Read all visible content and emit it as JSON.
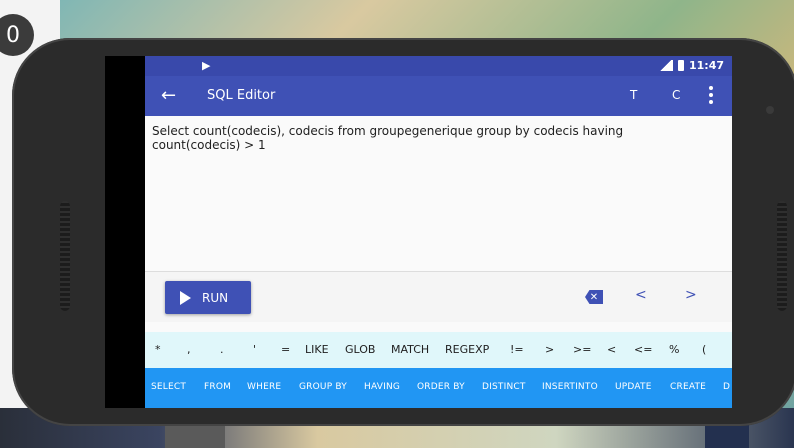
{
  "desktop": {
    "circle_letter": "0"
  },
  "statusbar": {
    "play_icon": "play-store-notification-icon",
    "signal_icon": "signal-icon",
    "battery_icon": "battery-icon",
    "time": "11:47"
  },
  "toolbar": {
    "back_icon": "back-arrow-icon",
    "title": "SQL Editor",
    "t_label": "T",
    "c_label": "C",
    "more_icon": "more-vert-icon"
  },
  "editor": {
    "query": "Select count(codecis), codecis from groupegenerique group by codecis having count(codecis) > 1"
  },
  "actions": {
    "run_label": "RUN",
    "backspace_icon": "backspace-icon",
    "prev_label": "<",
    "next_label": ">"
  },
  "operators": [
    "*",
    ",",
    ".",
    "'",
    "=",
    "LIKE",
    "GLOB",
    "MATCH",
    "REGEXP",
    "!=",
    ">",
    ">=",
    "<",
    "<=",
    "%",
    "("
  ],
  "keywords": [
    "SELECT",
    "FROM",
    "WHERE",
    "GROUP BY",
    "HAVING",
    "ORDER BY",
    "DISTINCT",
    "INSERTINTO",
    "UPDATE",
    "CREATE",
    "D"
  ],
  "colors": {
    "primary": "#3f51b5",
    "primary_dark": "#3949ab",
    "keyword_bar": "#2196f3",
    "operator_bar": "#e0f7fa"
  }
}
